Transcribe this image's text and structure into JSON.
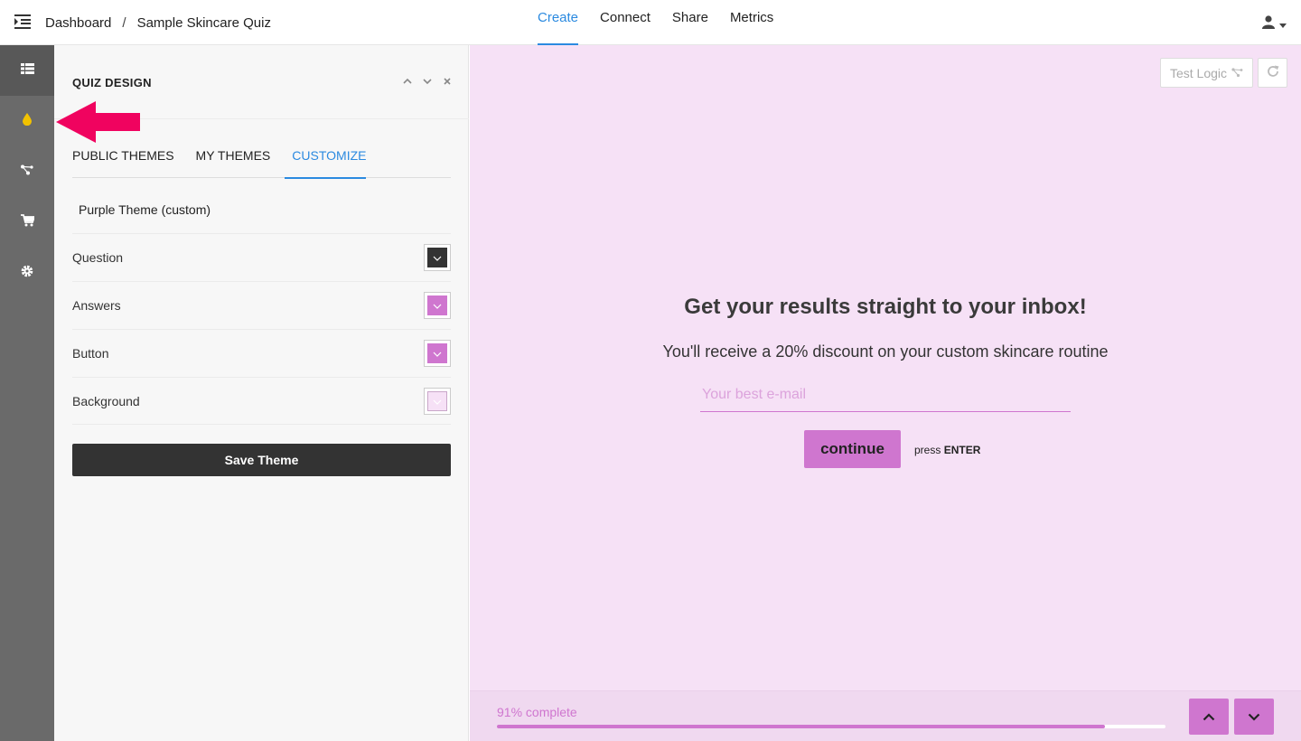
{
  "topbar": {
    "menu_icon": "indent-menu-icon",
    "breadcrumb": {
      "root": "Dashboard",
      "separator": "/",
      "current": "Sample Skincare Quiz"
    },
    "tabs": [
      {
        "label": "Create",
        "active": true
      },
      {
        "label": "Connect",
        "active": false
      },
      {
        "label": "Share",
        "active": false
      },
      {
        "label": "Metrics",
        "active": false
      }
    ],
    "user_icon": "user-icon"
  },
  "rail": {
    "items": [
      {
        "icon": "grid-list-icon",
        "active": true
      },
      {
        "icon": "paint-drop-icon",
        "active": false,
        "color": "#f2c200"
      },
      {
        "icon": "logic-branch-icon",
        "active": false
      },
      {
        "icon": "cart-icon",
        "active": false
      },
      {
        "icon": "gear-icon",
        "active": false
      }
    ]
  },
  "panel": {
    "title": "QUIZ DESIGN",
    "theme_tabs": [
      {
        "label": "PUBLIC THEMES",
        "active": false
      },
      {
        "label": "MY THEMES",
        "active": false
      },
      {
        "label": "CUSTOMIZE",
        "active": true
      }
    ],
    "theme_name": "Purple Theme (custom)",
    "color_rows": [
      {
        "label": "Question",
        "color": "#333333"
      },
      {
        "label": "Answers",
        "color": "#cf76cf"
      },
      {
        "label": "Button",
        "color": "#cf76cf"
      },
      {
        "label": "Background",
        "color": "#f6e1f6"
      }
    ],
    "save_label": "Save Theme"
  },
  "preview": {
    "test_logic_label": "Test Logic",
    "title": "Get your results straight to your inbox!",
    "subtitle": "You'll receive a 20% discount on your custom skincare routine",
    "email_placeholder": "Your best e-mail",
    "continue_label": "continue",
    "hint_prefix": "press",
    "hint_key": "ENTER",
    "progress_text": "91% complete",
    "progress": 0.91,
    "accent": "#cf76cf",
    "background": "#f6e1f6"
  },
  "annotation": {
    "arrow_color": "#f0035f"
  }
}
